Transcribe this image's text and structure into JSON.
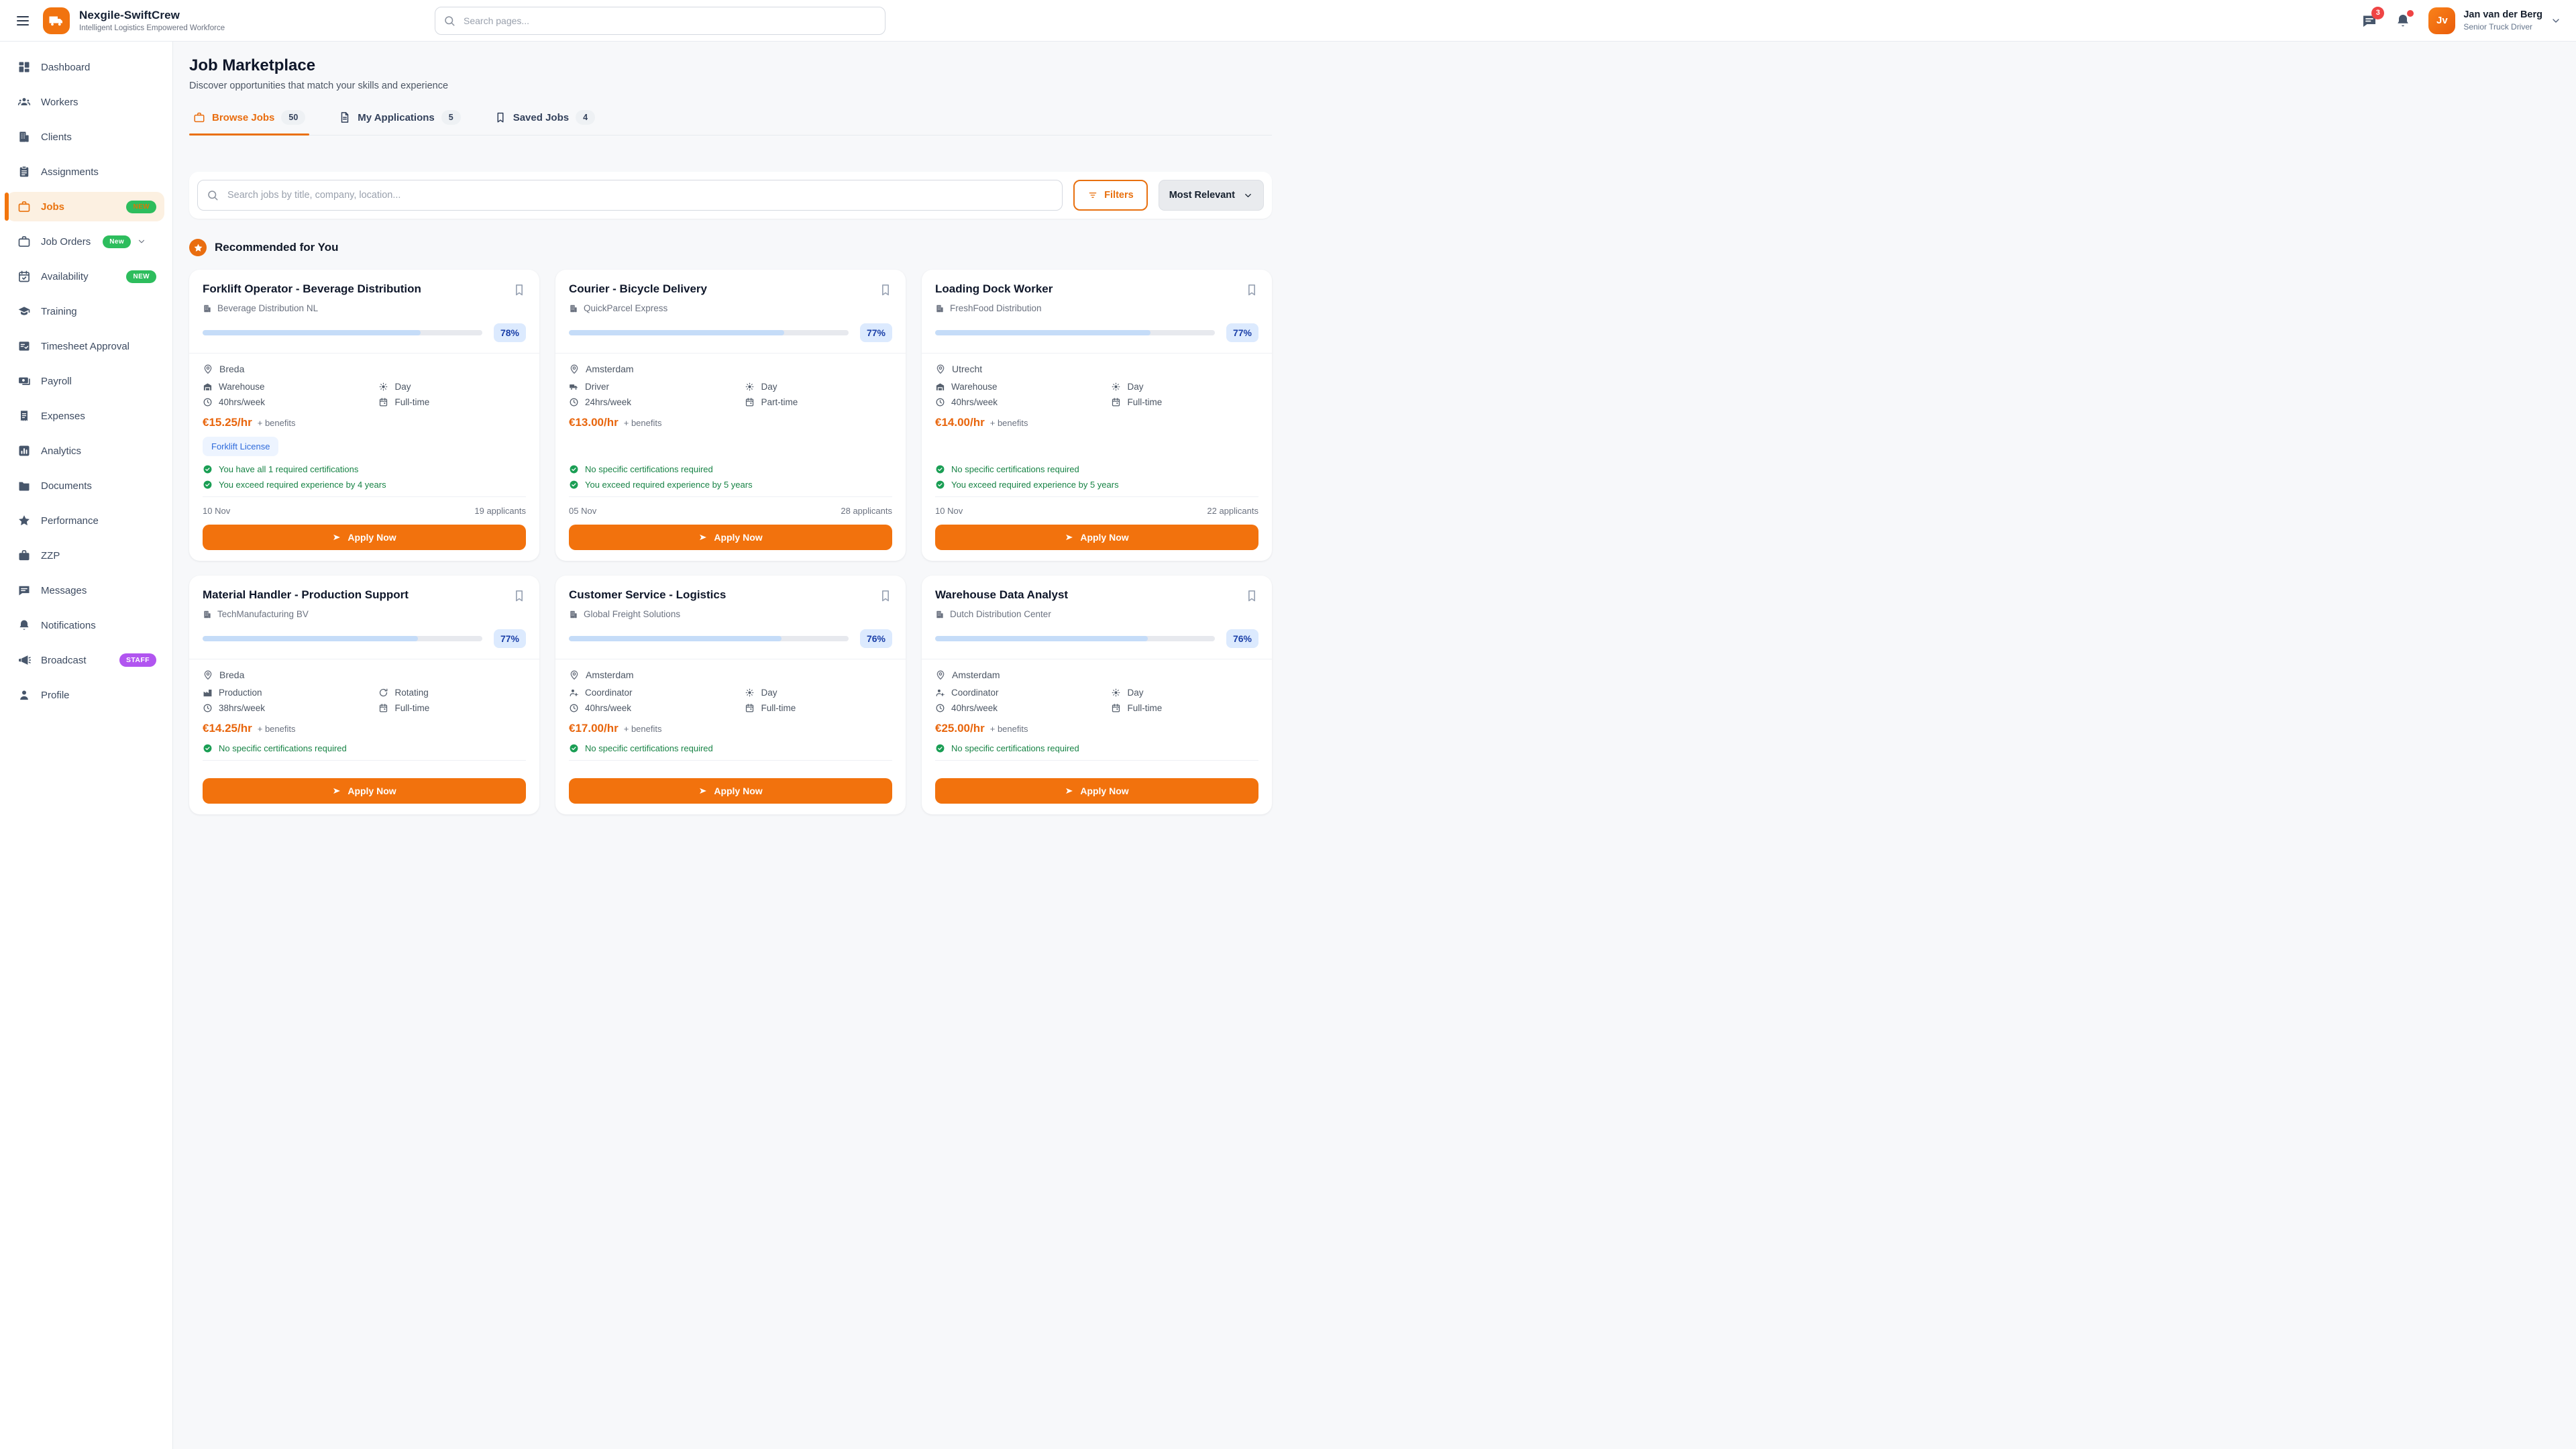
{
  "theme": {
    "accent": "#f2720d",
    "accent_text": "#e8700f",
    "green_badge": "#2dbd5d",
    "purple_badge": "#b155f0",
    "red_badge": "#ef4444",
    "progress_fill": "#c5dcf8",
    "match_pill_bg": "#dceafe",
    "match_pill_text": "#1a3fa8",
    "check_green": "#178345",
    "tag_blue": "#2f6bdb",
    "active_item_bg": "#fcf0e1"
  },
  "header": {
    "menu_icon": "menu",
    "logo_icon": "truck",
    "app_title": "Nexgile-SwiftCrew",
    "app_subtitle": "Intelligent Logistics Empowered Workforce",
    "search_placeholder": "Search pages...",
    "messages_icon": "message",
    "messages_badge": "3",
    "notifications_icon": "bell",
    "notifications_has_dot": true,
    "user": {
      "initials": "Jv",
      "name": "Jan van der Berg",
      "role": "Senior Truck Driver"
    }
  },
  "sidebar": {
    "items": [
      {
        "label": "Dashboard",
        "icon": "dashboard"
      },
      {
        "label": "Workers",
        "icon": "users"
      },
      {
        "label": "Clients",
        "icon": "building"
      },
      {
        "label": "Assignments",
        "icon": "clipboard"
      },
      {
        "label": "Jobs",
        "icon": "briefcase",
        "active": true,
        "badge": {
          "text": "NEW",
          "style": "green-orange"
        }
      },
      {
        "label": "Job Orders",
        "icon": "briefcase",
        "badge": {
          "text": "New",
          "style": "green"
        },
        "chevron": true
      },
      {
        "label": "Availability",
        "icon": "calendar-check",
        "badge": {
          "text": "NEW",
          "style": "green"
        }
      },
      {
        "label": "Training",
        "icon": "graduation-cap"
      },
      {
        "label": "Timesheet Approval",
        "icon": "list-check"
      },
      {
        "label": "Payroll",
        "icon": "banknote"
      },
      {
        "label": "Expenses",
        "icon": "receipt"
      },
      {
        "label": "Analytics",
        "icon": "bar-chart"
      },
      {
        "label": "Documents",
        "icon": "folder"
      },
      {
        "label": "Performance",
        "icon": "star"
      },
      {
        "label": "ZZP",
        "icon": "briefcase-filled"
      },
      {
        "label": "Messages",
        "icon": "message"
      },
      {
        "label": "Notifications",
        "icon": "bell"
      },
      {
        "label": "Broadcast",
        "icon": "megaphone",
        "badge": {
          "text": "STAFF",
          "style": "purple"
        }
      },
      {
        "label": "Profile",
        "icon": "user"
      }
    ]
  },
  "page": {
    "title": "Job Marketplace",
    "subtitle": "Discover opportunities that match your skills and experience"
  },
  "tabs": {
    "items": [
      {
        "label": "Browse Jobs",
        "count": "50",
        "icon": "briefcase",
        "active": true
      },
      {
        "label": "My Applications",
        "count": "5",
        "icon": "file-text",
        "active": false
      },
      {
        "label": "Saved Jobs",
        "count": "4",
        "icon": "bookmark",
        "active": false
      }
    ]
  },
  "toolbar": {
    "search_placeholder": "Search jobs by title, company, location...",
    "search_icon": "search",
    "filters_label": "Filters",
    "filters_icon": "filter",
    "sort_value": "Most Relevant"
  },
  "section": {
    "title": "Recommended for You",
    "icon": "star"
  },
  "jobs": [
    {
      "title": "Forklift Operator - Beverage Distribution",
      "company": "Beverage Distribution NL",
      "match_percent": 78,
      "match_label": "78%",
      "location": "Breda",
      "category": {
        "label": "Warehouse",
        "icon": "warehouse"
      },
      "shift": {
        "label": "Day",
        "icon": "sun"
      },
      "hours": "40hrs/week",
      "employment_type": "Full-time",
      "rate": "€15.25/hr",
      "rate_note": "+ benefits",
      "tags": [
        "Forklift License"
      ],
      "checks": [
        "You have all 1 required certifications",
        "You exceed required experience by 4 years"
      ],
      "posted": "10 Nov",
      "applicants": "19 applicants",
      "apply_label": "Apply Now"
    },
    {
      "title": "Courier - Bicycle Delivery",
      "company": "QuickParcel Express",
      "match_percent": 77,
      "match_label": "77%",
      "location": "Amsterdam",
      "category": {
        "label": "Driver",
        "icon": "truck-small"
      },
      "shift": {
        "label": "Day",
        "icon": "sun"
      },
      "hours": "24hrs/week",
      "employment_type": "Part-time",
      "rate": "€13.00/hr",
      "rate_note": "+ benefits",
      "tags": [],
      "checks": [
        "No specific certifications required",
        "You exceed required experience by 5 years"
      ],
      "posted": "05 Nov",
      "applicants": "28 applicants",
      "apply_label": "Apply Now"
    },
    {
      "title": "Loading Dock Worker",
      "company": "FreshFood Distribution",
      "match_percent": 77,
      "match_label": "77%",
      "location": "Utrecht",
      "category": {
        "label": "Warehouse",
        "icon": "warehouse"
      },
      "shift": {
        "label": "Day",
        "icon": "sun"
      },
      "hours": "40hrs/week",
      "employment_type": "Full-time",
      "rate": "€14.00/hr",
      "rate_note": "+ benefits",
      "tags": [],
      "checks": [
        "No specific certifications required",
        "You exceed required experience by 5 years"
      ],
      "posted": "10 Nov",
      "applicants": "22 applicants",
      "apply_label": "Apply Now"
    },
    {
      "title": "Material Handler - Production Support",
      "company": "TechManufacturing BV",
      "match_percent": 77,
      "match_label": "77%",
      "location": "Breda",
      "category": {
        "label": "Production",
        "icon": "factory"
      },
      "shift": {
        "label": "Rotating",
        "icon": "rotate"
      },
      "hours": "38hrs/week",
      "employment_type": "Full-time",
      "rate": "€14.25/hr",
      "rate_note": "+ benefits",
      "tags": [],
      "checks": [
        "No specific certifications required"
      ],
      "posted": "",
      "applicants": "",
      "apply_label": "Apply Now"
    },
    {
      "title": "Customer Service - Logistics",
      "company": "Global Freight Solutions",
      "match_percent": 76,
      "match_label": "76%",
      "location": "Amsterdam",
      "category": {
        "label": "Coordinator",
        "icon": "user-gear"
      },
      "shift": {
        "label": "Day",
        "icon": "sun"
      },
      "hours": "40hrs/week",
      "employment_type": "Full-time",
      "rate": "€17.00/hr",
      "rate_note": "+ benefits",
      "tags": [],
      "checks": [
        "No specific certifications required"
      ],
      "posted": "",
      "applicants": "",
      "apply_label": "Apply Now"
    },
    {
      "title": "Warehouse Data Analyst",
      "company": "Dutch Distribution Center",
      "match_percent": 76,
      "match_label": "76%",
      "location": "Amsterdam",
      "category": {
        "label": "Coordinator",
        "icon": "user-gear"
      },
      "shift": {
        "label": "Day",
        "icon": "sun"
      },
      "hours": "40hrs/week",
      "employment_type": "Full-time",
      "rate": "€25.00/hr",
      "rate_note": "+ benefits",
      "tags": [],
      "checks": [
        "No specific certifications required"
      ],
      "posted": "",
      "applicants": "",
      "apply_label": "Apply Now"
    }
  ]
}
